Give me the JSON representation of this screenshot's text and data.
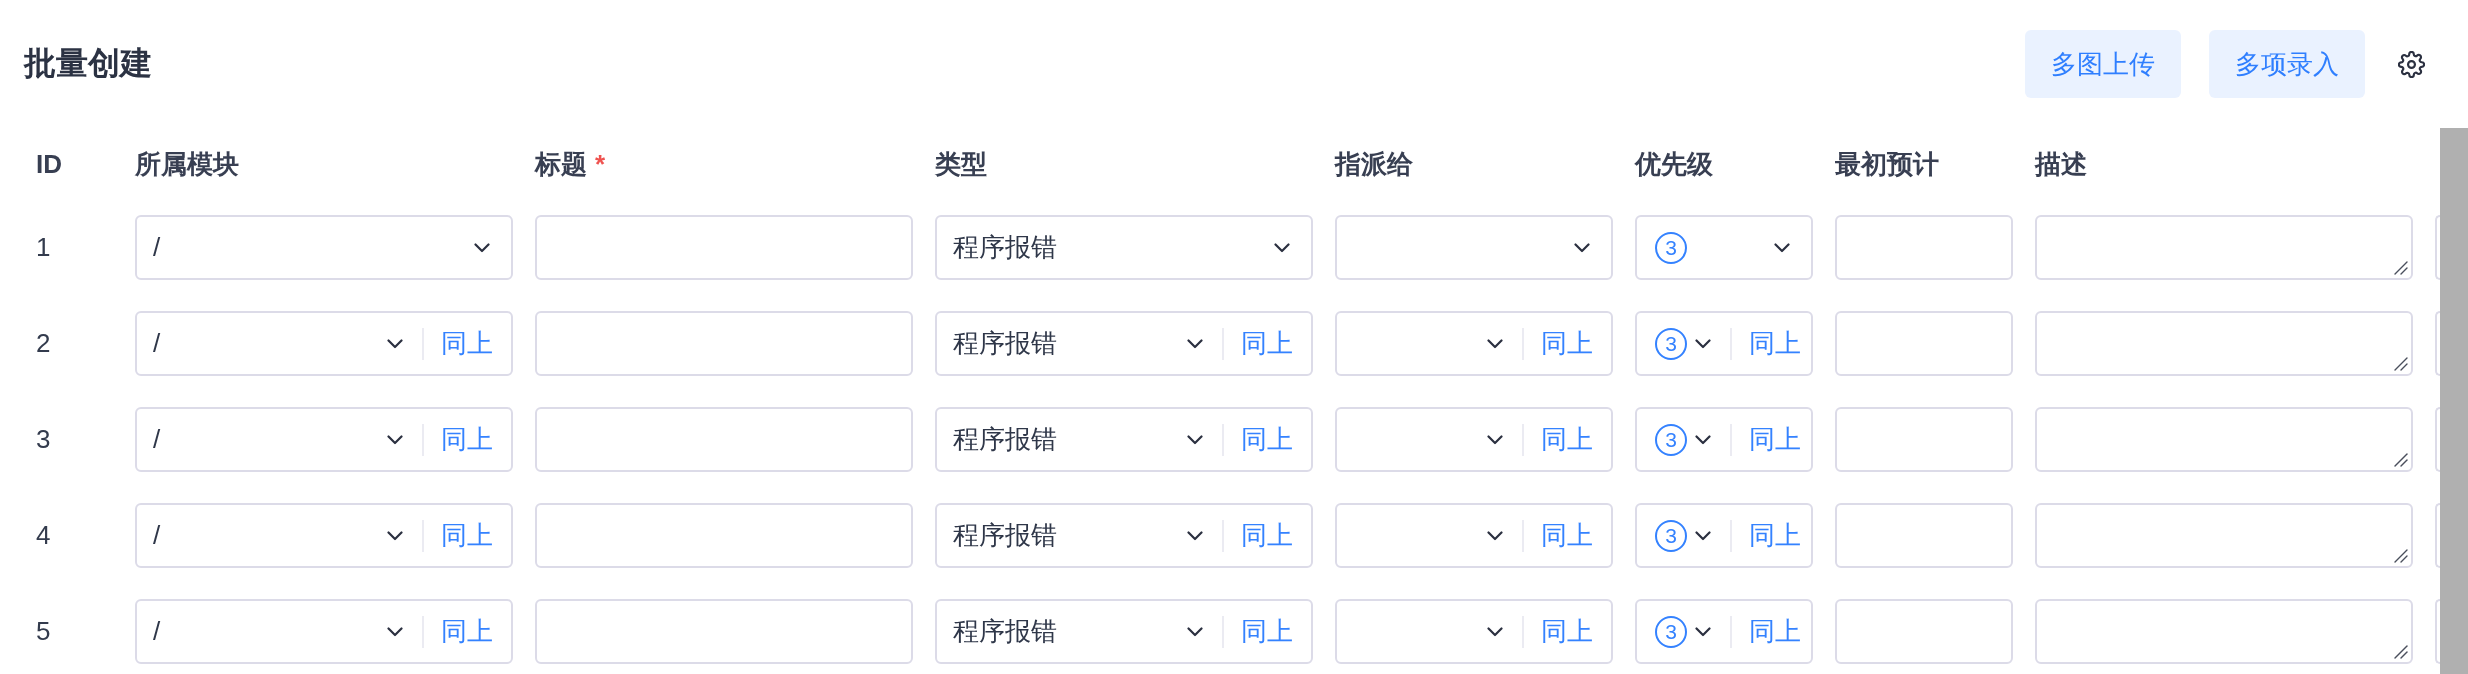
{
  "title": "批量创建",
  "toolbar": {
    "buttons": [
      "多图上传",
      "多项录入"
    ]
  },
  "table": {
    "columns": [
      {
        "label": "ID"
      },
      {
        "label": "所属模块"
      },
      {
        "label": "标题",
        "marker": "*"
      },
      {
        "label": "类型"
      },
      {
        "label": "指派给"
      },
      {
        "label": "优先级"
      },
      {
        "label": "最初预计"
      },
      {
        "label": "描述"
      }
    ],
    "rows": [
      {
        "cells": [
          {
            "kind": "id",
            "value": "1"
          },
          {
            "kind": "select",
            "value": "/"
          },
          {
            "kind": "text"
          },
          {
            "kind": "select",
            "value": "程序报错"
          },
          {
            "kind": "select"
          },
          {
            "kind": "priority",
            "value": "3"
          },
          {
            "kind": "text"
          },
          {
            "kind": "textarea"
          },
          {
            "kind": "partial"
          }
        ]
      },
      {
        "cells": [
          {
            "kind": "id",
            "value": "2"
          },
          {
            "kind": "select",
            "value": "/",
            "copy_label": "同上"
          },
          {
            "kind": "text"
          },
          {
            "kind": "select",
            "value": "程序报错",
            "copy_label": "同上"
          },
          {
            "kind": "select",
            "copy_label": "同上"
          },
          {
            "kind": "priority",
            "value": "3",
            "copy_label": "同上"
          },
          {
            "kind": "text"
          },
          {
            "kind": "textarea"
          },
          {
            "kind": "partial"
          }
        ]
      },
      {
        "cells": [
          {
            "kind": "id",
            "value": "3"
          },
          {
            "kind": "select",
            "value": "/",
            "copy_label": "同上"
          },
          {
            "kind": "text"
          },
          {
            "kind": "select",
            "value": "程序报错",
            "copy_label": "同上"
          },
          {
            "kind": "select",
            "copy_label": "同上"
          },
          {
            "kind": "priority",
            "value": "3",
            "copy_label": "同上"
          },
          {
            "kind": "text"
          },
          {
            "kind": "textarea"
          },
          {
            "kind": "partial"
          }
        ]
      },
      {
        "cells": [
          {
            "kind": "id",
            "value": "4"
          },
          {
            "kind": "select",
            "value": "/",
            "copy_label": "同上"
          },
          {
            "kind": "text"
          },
          {
            "kind": "select",
            "value": "程序报错",
            "copy_label": "同上"
          },
          {
            "kind": "select",
            "copy_label": "同上"
          },
          {
            "kind": "priority",
            "value": "3",
            "copy_label": "同上"
          },
          {
            "kind": "text"
          },
          {
            "kind": "textarea"
          },
          {
            "kind": "partial"
          }
        ]
      },
      {
        "cells": [
          {
            "kind": "id",
            "value": "5"
          },
          {
            "kind": "select",
            "value": "/",
            "copy_label": "同上"
          },
          {
            "kind": "text"
          },
          {
            "kind": "select",
            "value": "程序报错",
            "copy_label": "同上"
          },
          {
            "kind": "select",
            "copy_label": "同上"
          },
          {
            "kind": "priority",
            "value": "3",
            "copy_label": "同上"
          },
          {
            "kind": "text"
          },
          {
            "kind": "textarea"
          },
          {
            "kind": "partial"
          }
        ]
      }
    ]
  }
}
